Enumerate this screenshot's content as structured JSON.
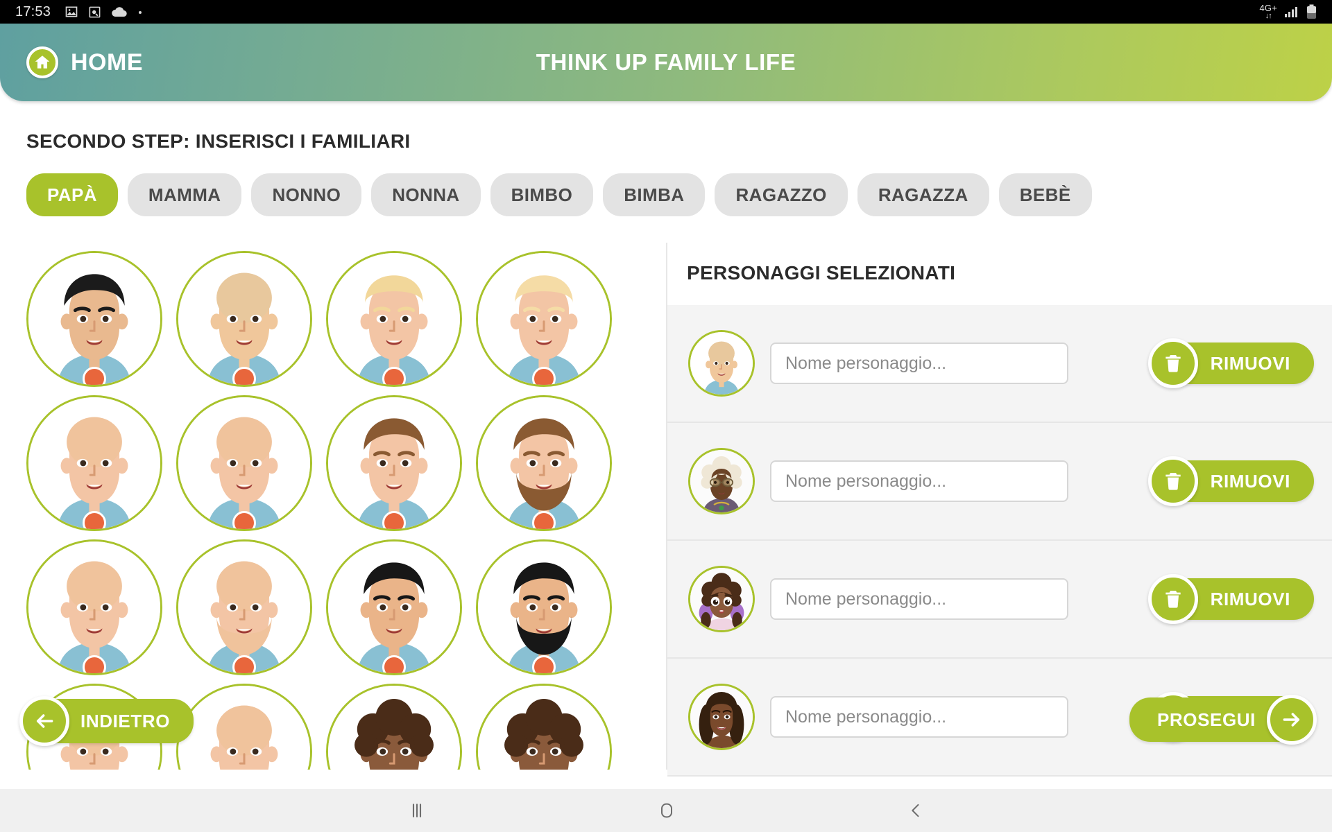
{
  "status_bar": {
    "clock": "17:53",
    "left_icons": [
      "image-icon",
      "image-search-icon",
      "cloud-icon",
      "dot-icon"
    ],
    "network_label": "4G+",
    "right_icons": [
      "data-transfer-icon",
      "signal-icon",
      "battery-icon"
    ]
  },
  "header": {
    "home_label": "HOME",
    "home_icon": "house-icon",
    "title": "THINK UP FAMILY LIFE",
    "gradient_from": "#5fa0a0",
    "gradient_to": "#bdd147"
  },
  "page": {
    "step_title": "SECONDO STEP: INSERISCI I FAMILIARI",
    "accent_color": "#a8c22b",
    "tab_inactive_bg": "#e3e3e3"
  },
  "tabs": [
    {
      "label": "PAPÀ",
      "active": true
    },
    {
      "label": "MAMMA",
      "active": false
    },
    {
      "label": "NONNO",
      "active": false
    },
    {
      "label": "NONNA",
      "active": false
    },
    {
      "label": "BIMBO",
      "active": false
    },
    {
      "label": "BIMBA",
      "active": false
    },
    {
      "label": "RAGAZZO",
      "active": false
    },
    {
      "label": "RAGAZZA",
      "active": false
    },
    {
      "label": "BEBÈ",
      "active": false
    }
  ],
  "avatar_grid": {
    "items": [
      {
        "id": "avatar-1",
        "hair": "black-short",
        "skin": "#e9b98f",
        "hair_color": "#1b1b1b",
        "shirt": "#89c0d3",
        "beard": "none"
      },
      {
        "id": "avatar-2",
        "hair": "bald",
        "skin": "#f0c79b",
        "hair_color": "#e8c89d",
        "shirt": "#89c0d3",
        "beard": "none"
      },
      {
        "id": "avatar-3",
        "hair": "blond-short",
        "skin": "#f3c5a5",
        "hair_color": "#f2d79a",
        "shirt": "#89c0d3",
        "beard": "none"
      },
      {
        "id": "avatar-4",
        "hair": "blond-short",
        "skin": "#f3c5a5",
        "hair_color": "#f5dca6",
        "shirt": "#89c0d3",
        "beard": "none"
      },
      {
        "id": "avatar-5",
        "hair": "bald",
        "skin": "#f3c5a5",
        "hair_color": "#f0c39c",
        "shirt": "#89c0d3",
        "beard": "none"
      },
      {
        "id": "avatar-6",
        "hair": "bald",
        "skin": "#f3c5a5",
        "hair_color": "#f0c39c",
        "shirt": "#89c0d3",
        "beard": "none"
      },
      {
        "id": "avatar-7",
        "hair": "brown-short",
        "skin": "#f3c5a5",
        "hair_color": "#8a5a32",
        "shirt": "#89c0d3",
        "beard": "none"
      },
      {
        "id": "avatar-8",
        "hair": "brown-short",
        "skin": "#f3c5a5",
        "hair_color": "#8a5a32",
        "shirt": "#89c0d3",
        "beard": "full"
      },
      {
        "id": "avatar-9",
        "hair": "bald",
        "skin": "#f3c5a5",
        "hair_color": "#f0c39c",
        "shirt": "#89c0d3",
        "beard": "none"
      },
      {
        "id": "avatar-10",
        "hair": "bald",
        "skin": "#f3c5a5",
        "hair_color": "#f0c39c",
        "shirt": "#89c0d3",
        "beard": "full"
      },
      {
        "id": "avatar-11",
        "hair": "black-short",
        "skin": "#eab489",
        "hair_color": "#171717",
        "shirt": "#89c0d3",
        "beard": "none"
      },
      {
        "id": "avatar-12",
        "hair": "black-short",
        "skin": "#eab489",
        "hair_color": "#171717",
        "shirt": "#89c0d3",
        "beard": "full"
      },
      {
        "id": "avatar-13",
        "hair": "bald",
        "skin": "#f3c5a5",
        "hair_color": "#f0c39c",
        "shirt": "#89c0d3",
        "beard": "none"
      },
      {
        "id": "avatar-14",
        "hair": "bald",
        "skin": "#f3c5a5",
        "hair_color": "#f0c39c",
        "shirt": "#89c0d3",
        "beard": "none"
      },
      {
        "id": "avatar-15",
        "hair": "curly-dark",
        "skin": "#8a5a3b",
        "hair_color": "#4a2c18",
        "shirt": "#89c0d3",
        "beard": "none"
      },
      {
        "id": "avatar-16",
        "hair": "curly-dark",
        "skin": "#8a5a3b",
        "hair_color": "#4a2c18",
        "shirt": "#89c0d3",
        "beard": "none"
      }
    ]
  },
  "selected_panel": {
    "title": "PERSONAGGI SELEZIONATI",
    "name_placeholder": "Nome personaggio...",
    "remove_label": "RIMUOVI",
    "remove_icon": "trash-icon",
    "rows": [
      {
        "avatar": "bald-man",
        "name_value": "",
        "skin": "#f0c79b",
        "hair_color": "#e8c89d",
        "shirt": "#89c0d3"
      },
      {
        "avatar": "grandmother",
        "name_value": "",
        "skin": "#6b4326",
        "hair_color": "#efe7d6",
        "shirt": "#6b5b74"
      },
      {
        "avatar": "young-girl",
        "name_value": "",
        "skin": "#8a5a3b",
        "hair_color": "#4a2c18",
        "shirt": "#a770c9"
      },
      {
        "avatar": "woman",
        "name_value": "",
        "skin": "#7a4a2c",
        "hair_color": "#35200f",
        "shirt": "#7a4a2c"
      }
    ]
  },
  "nav_buttons": {
    "back_label": "INDIETRO",
    "back_icon": "arrow-left-icon",
    "next_label": "PROSEGUI",
    "next_icon": "arrow-right-icon"
  },
  "system_nav": {
    "recents_icon": "recents-icon",
    "home_icon": "home-square-icon",
    "back_icon": "chevron-left-icon"
  }
}
